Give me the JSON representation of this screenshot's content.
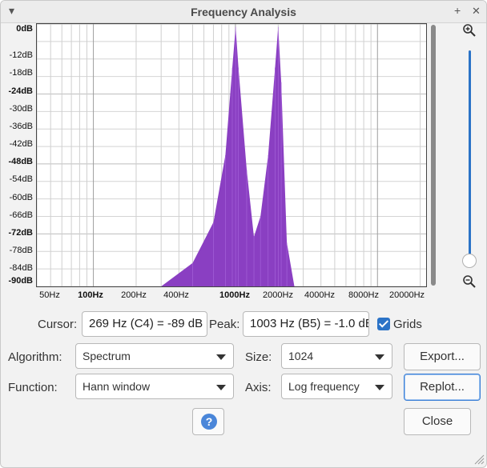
{
  "window": {
    "title": "Frequency Analysis",
    "menu_glyph": "▾",
    "add_glyph": "+",
    "close_glyph": "✕"
  },
  "plot": {
    "y_labels": [
      "0dB",
      "-12dB",
      "-18dB",
      "-24dB",
      "-30dB",
      "-36dB",
      "-42dB",
      "-48dB",
      "-54dB",
      "-60dB",
      "-66dB",
      "-72dB",
      "-78dB",
      "-84dB",
      "-90dB"
    ],
    "x_labels": [
      "50Hz",
      "100Hz",
      "200Hz",
      "400Hz",
      "1000Hz",
      "2000Hz",
      "4000Hz",
      "8000Hz",
      "20000Hz"
    ],
    "fill_color": "#8a3fc2"
  },
  "chart_data": {
    "type": "area",
    "x_scale": "log",
    "xlim": [
      40,
      22000
    ],
    "ylim": [
      -90,
      0
    ],
    "x": [
      300,
      500,
      700,
      850,
      950,
      1003,
      1050,
      1200,
      1350,
      1500,
      1700,
      1900,
      2000,
      2100,
      2300,
      2600
    ],
    "y": [
      -90,
      -82,
      -68,
      -45,
      -15,
      -1,
      -15,
      -50,
      -73,
      -66,
      -45,
      -15,
      -1,
      -20,
      -75,
      -90
    ]
  },
  "zoom": {
    "in_icon": "zoom-in",
    "out_icon": "zoom-out",
    "level": 0.05
  },
  "readout": {
    "cursor_label": "Cursor:",
    "cursor_value": "269 Hz (C4) = -89 dB",
    "peak_label": "Peak:",
    "peak_value": "1003 Hz (B5) = -1.0 dB",
    "grids_label": "Grids",
    "grids_checked": true
  },
  "controls": {
    "algorithm_label": "Algorithm:",
    "algorithm_value": "Spectrum",
    "size_label": "Size:",
    "size_value": "1024",
    "function_label": "Function:",
    "function_value": "Hann window",
    "axis_label": "Axis:",
    "axis_value": "Log frequency"
  },
  "buttons": {
    "export": "Export...",
    "replot": "Replot...",
    "close": "Close",
    "help": "?"
  },
  "colors": {
    "accent": "#2b73c7",
    "spectrum": "#8a3fc2"
  }
}
